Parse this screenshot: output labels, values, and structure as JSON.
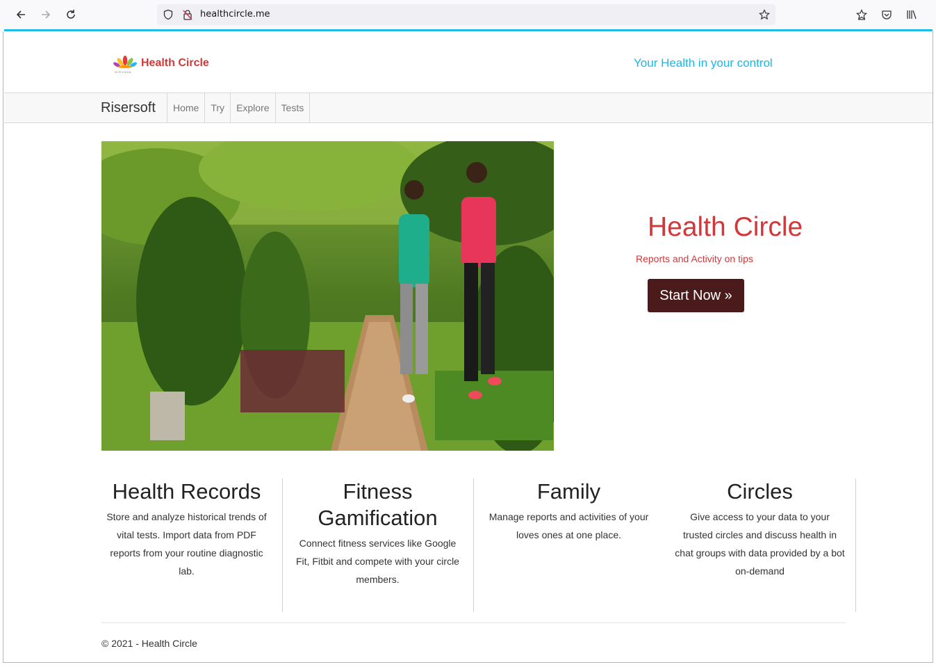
{
  "browser": {
    "url": "healthcircle.me"
  },
  "header": {
    "brand_name": "Health Circle",
    "logo_subtext": "NIRVANA",
    "tagline": "Your Health in your control"
  },
  "navbar": {
    "brand": "Risersoft",
    "links": [
      "Home",
      "Try",
      "Explore",
      "Tests"
    ]
  },
  "hero": {
    "image_alt": "two women jogging on a garden path",
    "title": "Health Circle",
    "subtitle": "Reports and Activity on tips",
    "button_label": "Start Now »"
  },
  "features": [
    {
      "title": "Health Records",
      "text": "Store and analyze historical trends of vital tests. Import data from PDF reports from your routine diagnostic lab."
    },
    {
      "title": "Fitness Gamification",
      "text": "Connect fitness services like Google Fit, Fitbit and compete with your circle members."
    },
    {
      "title": "Family",
      "text": "Manage reports and activities of your loves ones at one place."
    },
    {
      "title": "Circles",
      "text": "Give access to your data to your trusted circles and discuss health in chat groups with data provided by a bot on-demand"
    }
  ],
  "footer": {
    "text": "© 2021 - Health Circle"
  },
  "colors": {
    "accent": "#1fbce9",
    "brand_red": "#d0393a",
    "button_bg": "#4b1b1b"
  }
}
